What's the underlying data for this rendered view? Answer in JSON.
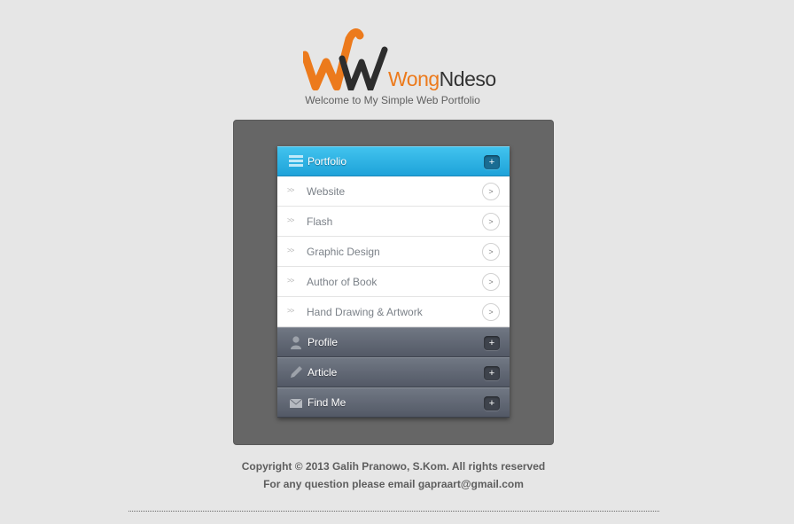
{
  "brand": {
    "logo_text_part1": "Wong",
    "logo_text_part2": "Ndeso",
    "tagline": "Welcome to My Simple Web Portfolio",
    "colors": {
      "orange": "#ec7a1c",
      "dark": "#333333"
    }
  },
  "menu": {
    "sections": [
      {
        "label": "Portfolio",
        "icon": "list-icon",
        "expand_glyph": "+",
        "active": true,
        "items": [
          {
            "label": "Website",
            "prefix": ">>",
            "go": ">"
          },
          {
            "label": "Flash",
            "prefix": ">>",
            "go": ">"
          },
          {
            "label": "Graphic Design",
            "prefix": ">>",
            "go": ">"
          },
          {
            "label": "Author of Book",
            "prefix": ">>",
            "go": ">"
          },
          {
            "label": "Hand Drawing & Artwork",
            "prefix": ">>",
            "go": ">"
          }
        ]
      },
      {
        "label": "Profile",
        "icon": "user-icon",
        "expand_glyph": "+",
        "active": false
      },
      {
        "label": "Article",
        "icon": "pencil-icon",
        "expand_glyph": "+",
        "active": false
      },
      {
        "label": "Find Me",
        "icon": "mail-icon",
        "expand_glyph": "+",
        "active": false
      }
    ],
    "colors": {
      "active_header": "#2fb2e4",
      "inactive_header": "#5f6572"
    }
  },
  "footer": {
    "copyright": "Copyright © 2013 Galih Pranowo, S.Kom.  All rights reserved",
    "contact": "For any question please email gapraart@gmail.com"
  }
}
